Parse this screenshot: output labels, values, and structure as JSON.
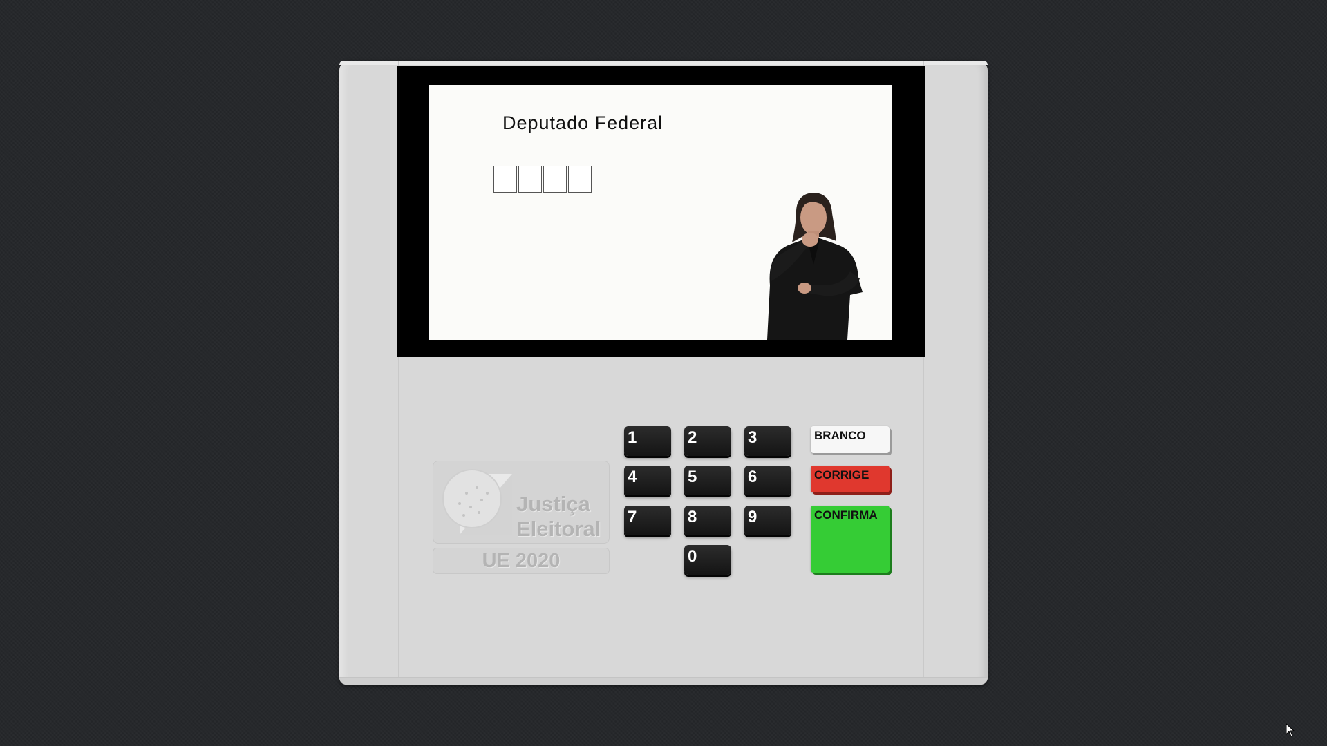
{
  "screen": {
    "office_title": "Deputado Federal",
    "digits": [
      "",
      "",
      "",
      ""
    ]
  },
  "logo": {
    "line1": "Justiça",
    "line2": "Eleitoral",
    "model": "UE 2020"
  },
  "keypad": {
    "keys": [
      "1",
      "2",
      "3",
      "4",
      "5",
      "6",
      "7",
      "8",
      "9",
      "0"
    ]
  },
  "function_keys": {
    "branco": "BRANCO",
    "corrige": "CORRIGE",
    "confirma": "CONFIRMA"
  },
  "colors": {
    "background": "#26282b",
    "urna_body": "#d8d8d8",
    "branco": "#f7f7f7",
    "corrige": "#e0382e",
    "confirma": "#35cc35"
  }
}
